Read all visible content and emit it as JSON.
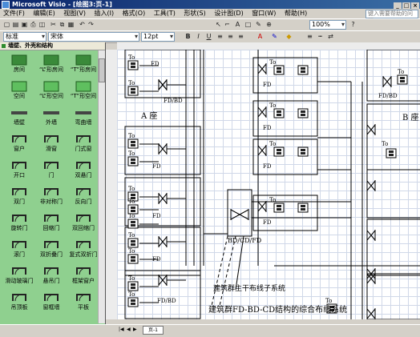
{
  "window": {
    "title": "Microsoft Visio - [绘图3:页-1]"
  },
  "menu": {
    "items": [
      "文件(F)",
      "编辑(E)",
      "视图(V)",
      "插入(I)",
      "格式(O)",
      "工具(T)",
      "形状(S)",
      "设计图(D)",
      "窗口(W)",
      "帮助(H)"
    ],
    "help_placeholder": "键入需要帮助的问题"
  },
  "toolbar": {
    "zoom": "100%",
    "style": "标准",
    "font": "宋体",
    "size": "12pt"
  },
  "stencil": {
    "title": "墙壁、外壳和结构",
    "shapes": [
      "房间",
      "“L”形房间",
      "“T”形房间",
      "空间",
      "“L”形空间",
      "“T”形空间",
      "墙壁",
      "外墙",
      "弯曲墙",
      "窗户",
      "滑窗",
      "门式窗",
      "开口",
      "门",
      "双悬门",
      "双门",
      "非对称门",
      "反向门",
      "旋转门",
      "回缩门",
      "双回缩门",
      "滚门",
      "双折叠门",
      "复式双折门",
      "滑动玻璃门",
      "悬吊门",
      "框架窗户",
      "吊顶板",
      "窗框墙",
      "平板"
    ]
  },
  "drawing": {
    "fd_label": "FD",
    "fdbd_label": "FD/BD",
    "to_label": "To",
    "building_a": "A 座",
    "building_b": "B 座",
    "center_label": "BD/CD/FD",
    "trunk_label": "建筑群主干布线子系统",
    "caption": "建筑群FD-BD-CD结构的综合布线系统"
  },
  "status": {
    "page_tab": "页-1"
  }
}
